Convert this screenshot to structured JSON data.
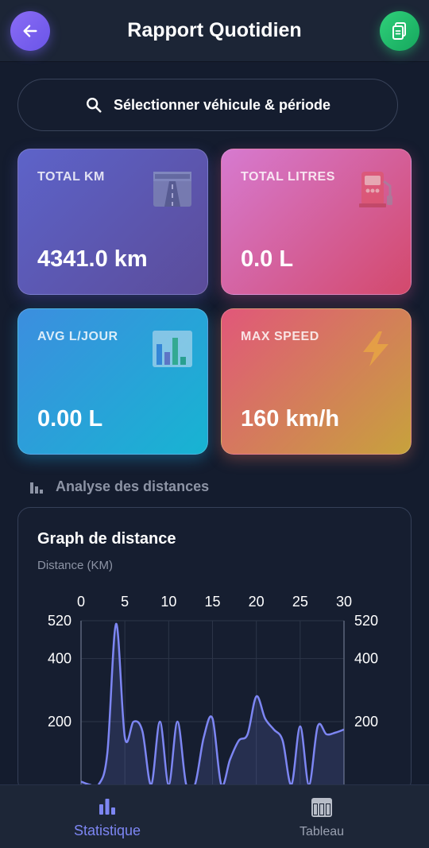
{
  "header": {
    "title": "Rapport Quotidien",
    "back_icon": "arrow-left-icon",
    "action_icon": "document-icon"
  },
  "search": {
    "label": "Sélectionner véhicule & période",
    "icon": "search-icon"
  },
  "cards": [
    {
      "label": "TOTAL KM",
      "value": "4341.0 km",
      "icon": "road-icon"
    },
    {
      "label": "TOTAL LITRES",
      "value": "0.0 L",
      "icon": "fuel-pump-icon"
    },
    {
      "label": "AVG L/JOUR",
      "value": "0.00 L",
      "icon": "bar-chart-icon"
    },
    {
      "label": "MAX SPEED",
      "value": "160 km/h",
      "icon": "lightning-icon"
    }
  ],
  "section": {
    "label": "Analyse des distances",
    "icon": "bar-chart-icon"
  },
  "chart": {
    "title": "Graph de distance",
    "subtitle": "Distance (KM)"
  },
  "chart_data": {
    "type": "line",
    "title": "Graph de distance",
    "ylabel": "Distance (KM)",
    "xlabel": "",
    "xlim": [
      0,
      30
    ],
    "ylim": [
      0,
      520
    ],
    "x_ticks": [
      "0",
      "5",
      "10",
      "15",
      "20",
      "25",
      "30"
    ],
    "y_ticks": [
      "520",
      "400",
      "200"
    ],
    "x": [
      0,
      1,
      2,
      3,
      4,
      5,
      6,
      7,
      8,
      9,
      10,
      11,
      12,
      13,
      14,
      15,
      16,
      17,
      18,
      19,
      20,
      21,
      22,
      23,
      24,
      25,
      26,
      27,
      28,
      29,
      30
    ],
    "values": [
      10,
      0,
      0,
      100,
      510,
      150,
      200,
      170,
      0,
      200,
      0,
      200,
      0,
      0,
      150,
      210,
      0,
      80,
      140,
      160,
      280,
      210,
      175,
      140,
      0,
      185,
      0,
      185,
      160,
      165,
      175
    ],
    "series_color": "#7d86f3",
    "grid": true
  },
  "bottom_nav": {
    "stat_label": "Statistique",
    "table_label": "Tableau",
    "stat_icon": "bar-chart-icon",
    "table_icon": "table-icon",
    "active_color": "#7d86f3"
  }
}
